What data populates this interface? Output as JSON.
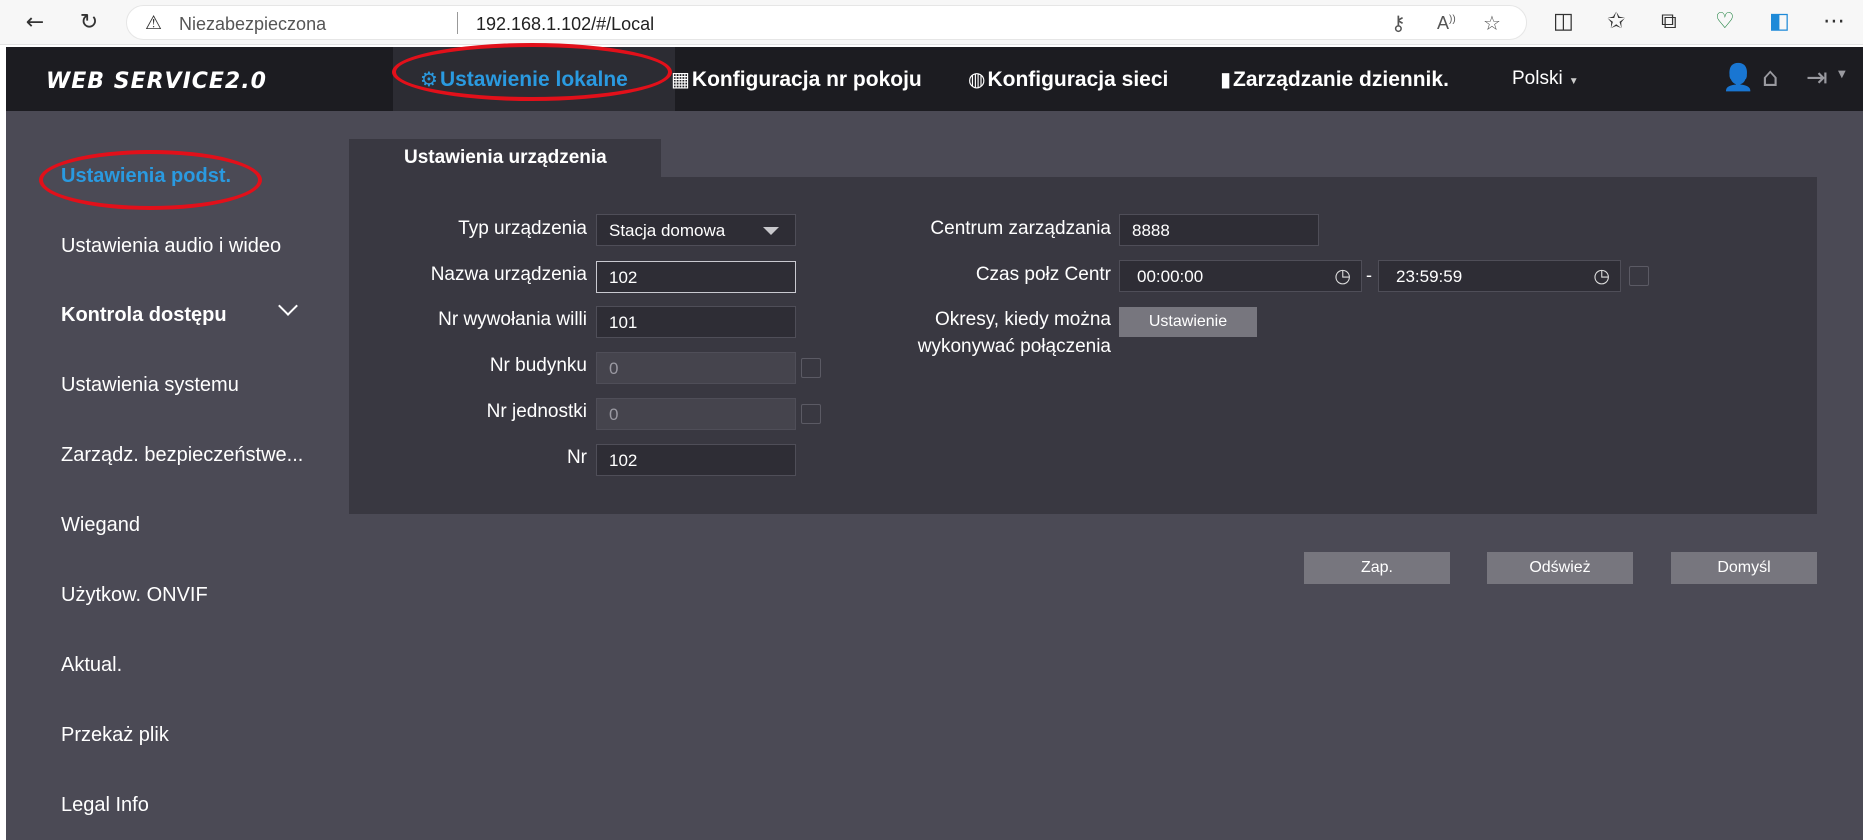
{
  "browser": {
    "back": "←",
    "reload": "↻",
    "warning_icon": "⚠",
    "insecure_label": "Niezabezpieczona",
    "url": "192.168.1.102/#/Local",
    "icons": [
      "key-icon",
      "read-aloud-icon",
      "star-icon",
      "split-screen-icon",
      "favorites-icon",
      "collections-icon",
      "health-icon",
      "edge-icon",
      "more-icon"
    ]
  },
  "app": {
    "logo": "WEB SERVICE2.0",
    "nav": [
      {
        "icon": "⚙",
        "label": "Ustawienie lokalne"
      },
      {
        "icon": "▦",
        "label": "Konfiguracja nr pokoju"
      },
      {
        "icon": "◍",
        "label": "Konfiguracja sieci"
      },
      {
        "icon": "▮",
        "label": "Zarządzanie dziennik."
      }
    ],
    "language": "Polski",
    "accent_color": "#2a9ae0",
    "annotation_color": "#e2101a"
  },
  "sidebar": {
    "items": [
      {
        "label": "Ustawienia podst."
      },
      {
        "label": "Ustawienia audio i wideo"
      },
      {
        "label": "Kontrola dostępu"
      },
      {
        "label": "Ustawienia systemu"
      },
      {
        "label": "Zarządz. bezpieczeństwe..."
      },
      {
        "label": "Wiegand"
      },
      {
        "label": "Użytkow. ONVIF"
      },
      {
        "label": "Aktual."
      },
      {
        "label": "Przekaż plik"
      },
      {
        "label": "Legal Info"
      }
    ]
  },
  "panel": {
    "tab": "Ustawienia urządzenia",
    "left": {
      "device_type": {
        "label": "Typ urządzenia",
        "value": "Stacja domowa"
      },
      "device_name": {
        "label": "Nazwa urządzenia",
        "value": "102"
      },
      "villa_call_no": {
        "label": "Nr wywołania willi",
        "value": "101"
      },
      "building_no": {
        "label": "Nr budynku",
        "value": "0"
      },
      "unit_no": {
        "label": "Nr jednostki",
        "value": "0"
      },
      "no": {
        "label": "Nr",
        "value": "102"
      }
    },
    "right": {
      "management_center": {
        "label": "Centrum zarządzania",
        "value": "8888"
      },
      "call_time": {
        "label": "Czas połz Centr",
        "from": "00:00:00",
        "separator": "-",
        "to": "23:59:59"
      },
      "call_periods": {
        "label_line1": "Okresy, kiedy można",
        "label_line2": "wykonywać połączenia",
        "button": "Ustawienie"
      }
    }
  },
  "actions": {
    "save": "Zap.",
    "refresh": "Odśwież",
    "default": "Domyśl"
  }
}
